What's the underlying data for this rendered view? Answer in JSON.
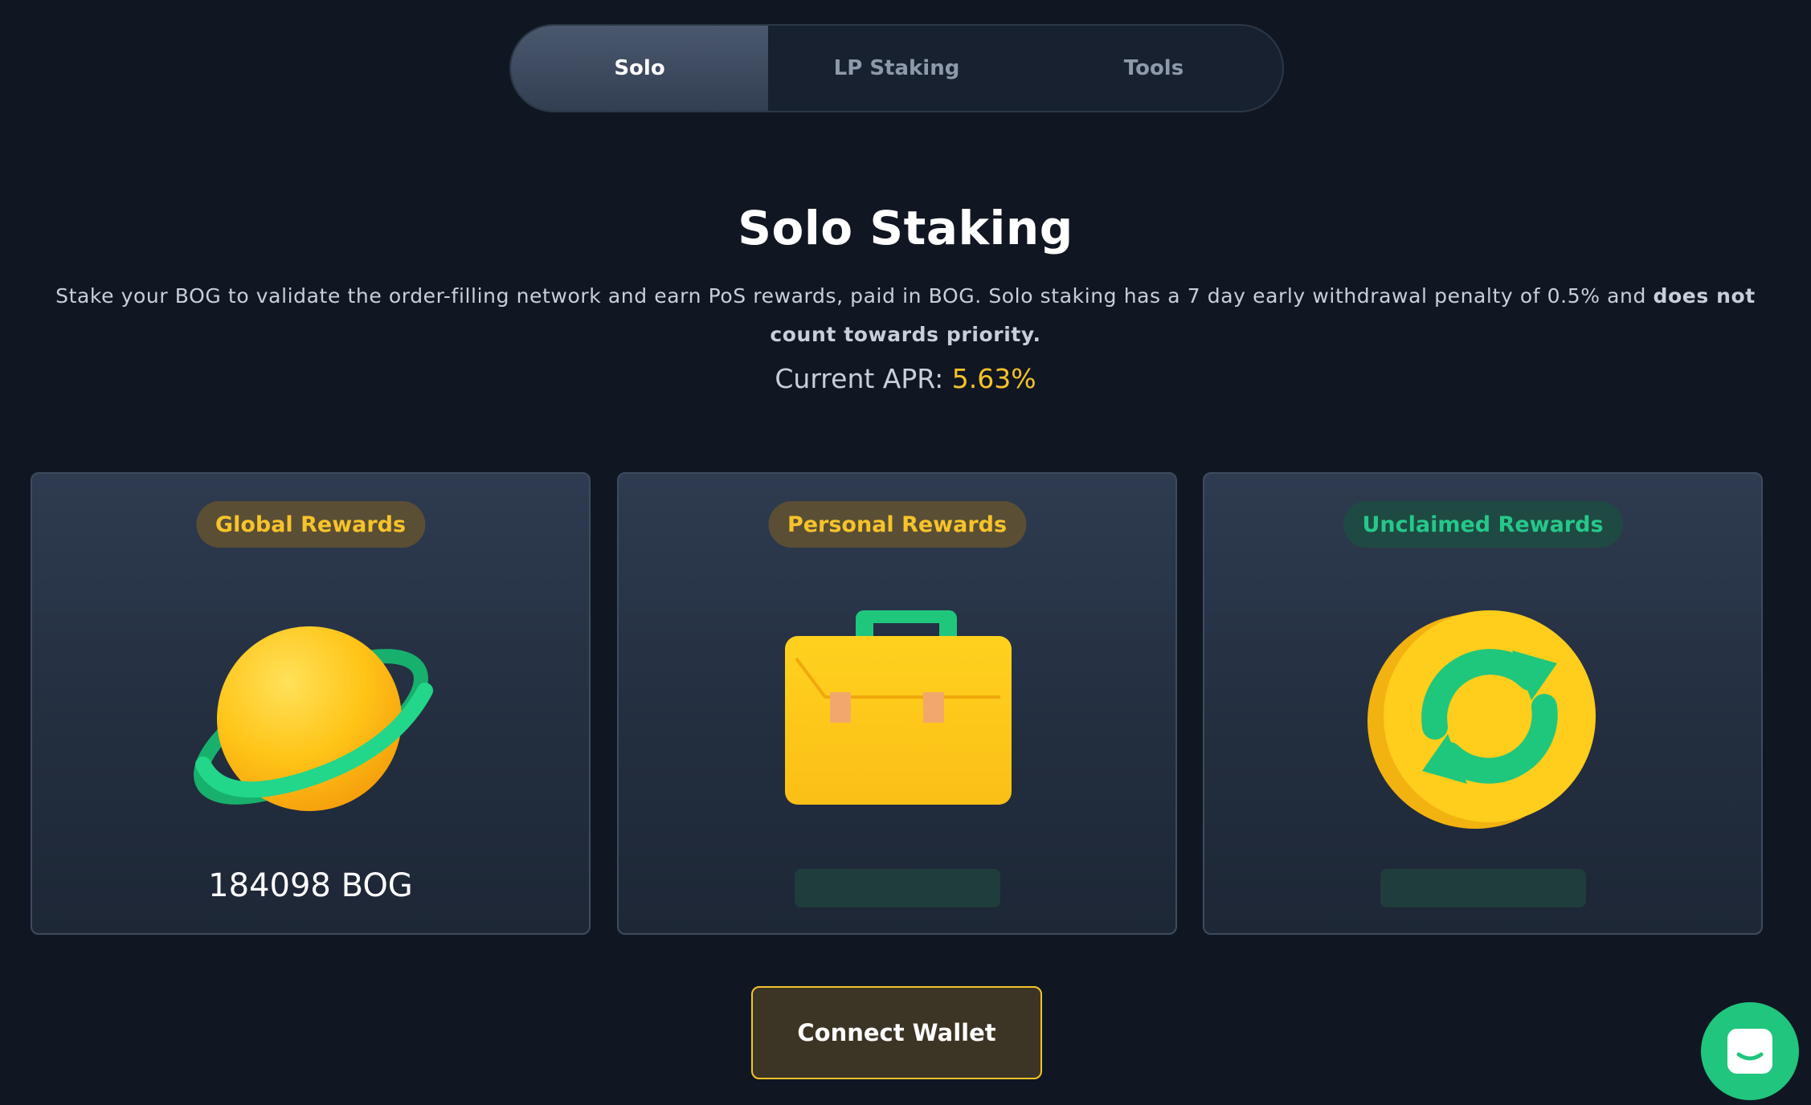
{
  "tabs": [
    {
      "label": "Solo",
      "active": true
    },
    {
      "label": "LP Staking",
      "active": false
    },
    {
      "label": "Tools",
      "active": false
    }
  ],
  "heading": "Solo Staking",
  "description": {
    "text": "Stake your BOG to validate the order-filling network and earn PoS rewards, paid in BOG. Solo staking has a 7 day early withdrawal penalty of 0.5% and ",
    "bold": "does not count towards priority."
  },
  "apr": {
    "label": "Current APR: ",
    "value": "5.63%"
  },
  "cards": [
    {
      "badge": "Global Rewards",
      "icon": "planet-icon",
      "amount": "184098 BOG"
    },
    {
      "badge": "Personal Rewards",
      "icon": "briefcase-icon",
      "amount": null,
      "loading": true
    },
    {
      "badge": "Unclaimed Rewards",
      "icon": "refresh-coin-icon",
      "amount": null,
      "loading": true
    }
  ],
  "connect_button": "Connect Wallet",
  "chat_widget": {
    "icon": "chat-bubble-icon"
  },
  "colors": {
    "background": "#101722",
    "accent_gold": "#f6c32a",
    "accent_green": "#25c88a"
  }
}
